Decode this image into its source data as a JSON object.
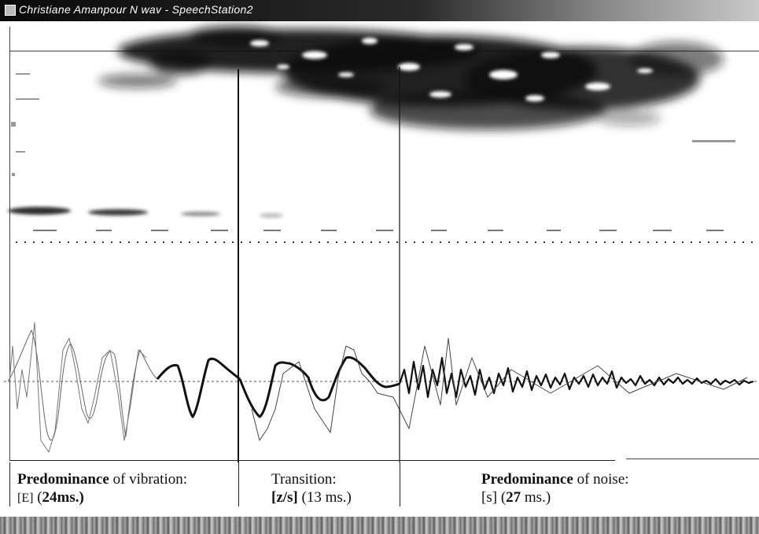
{
  "window": {
    "title": "Christiane Amanpour N wav - SpeechStation2"
  },
  "segments": [
    {
      "heading_bold": "Predominance",
      "heading_rest": " of vibration:",
      "phone": "[E]",
      "duration_open": " (",
      "duration_bold": "24",
      "duration_unit": "ms.)"
    },
    {
      "heading_bold": "",
      "heading_rest": "Transition:",
      "phone": "[z/s]",
      "duration_open": " (",
      "duration_bold": "13",
      "duration_unit": " ms.)"
    },
    {
      "heading_bold": "Predominance",
      "heading_rest": " of noise:",
      "phone": "[s]",
      "duration_open": " (",
      "duration_bold": "27",
      "duration_unit": " ms.)"
    }
  ],
  "colors": {
    "ink": "#111111",
    "titlebar": "#1a1a1a"
  }
}
